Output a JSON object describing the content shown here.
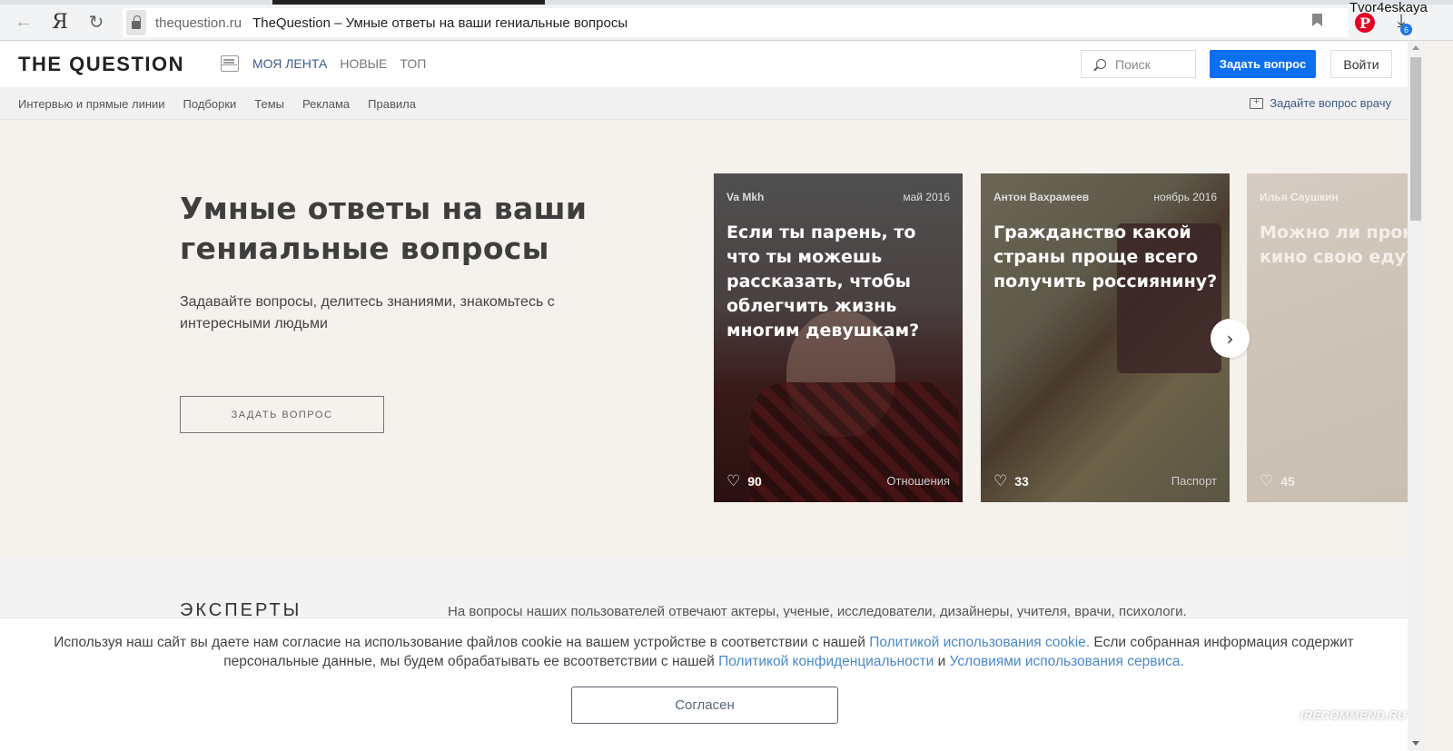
{
  "browser": {
    "url_domain": "thequestion.ru",
    "page_title": "TheQuestion – Умные ответы на ваши гениальные вопросы",
    "back_icon": "←",
    "yandex_icon": "Я",
    "reload_icon": "↻",
    "pinterest_icon": "P",
    "download_icon": "⤓",
    "download_badge": "6",
    "username": "Tvor4eskaya"
  },
  "header": {
    "logo": "THE QUESTION",
    "nav": [
      {
        "label": "МОЯ ЛЕНТА",
        "active": true
      },
      {
        "label": "НОВЫЕ",
        "active": false
      },
      {
        "label": "ТОП",
        "active": false
      }
    ],
    "search_placeholder": "Поиск",
    "ask_button": "Задать вопрос",
    "login_button": "Войти"
  },
  "subnav": {
    "links": [
      "Интервью и прямые линии",
      "Подборки",
      "Темы",
      "Реклама",
      "Правила"
    ],
    "doctor_link": "Задайте вопрос врачу"
  },
  "hero": {
    "title": "Умные ответы на ваши гениальные вопросы",
    "subtitle": "Задавайте вопросы, делитесь знаниями, знакомьтесь с интересными людьми",
    "ask_button": "ЗАДАТЬ ВОПРОС"
  },
  "cards": [
    {
      "author": "Va Mkh",
      "date": "май 2016",
      "question": "Если ты парень, то что ты можешь рассказать, чтобы облегчить жизнь многим девушкам?",
      "likes": "90",
      "tag": "Отношения"
    },
    {
      "author": "Антон Вахрамеев",
      "date": "ноябрь 2016",
      "question": "Гражданство какой страны проще всего получить россиянину?",
      "likes": "33",
      "tag": "Паспорт"
    },
    {
      "author": "Илья Саушкин",
      "date": "",
      "question": "Можно ли проносить в кино свою еду?",
      "likes": "45",
      "tag": ""
    }
  ],
  "carousel": {
    "next_icon": "›",
    "heart_icon": "♡"
  },
  "experts": {
    "title": "ЭКСПЕРТЫ",
    "text": "На вопросы наших пользователей отвечают актеры, ученые, исследователи, дизайнеры, учителя, врачи, психологи."
  },
  "cookie": {
    "text1": "Используя наш сайт вы даете нам согласие на использование файлов cookie на вашем устройстве в соответствии с нашей ",
    "link1": "Политикой использования cookie.",
    "text2": " Если собранная информация содержит персональные данные, мы будем обрабатывать ее всоответствии с нашей ",
    "link2": "Политикой конфиденциальности",
    "text3": " и ",
    "link3": "Условиями использования сервиса.",
    "agree_button": "Согласен"
  },
  "watermark": "IRECOMMEND.RU"
}
